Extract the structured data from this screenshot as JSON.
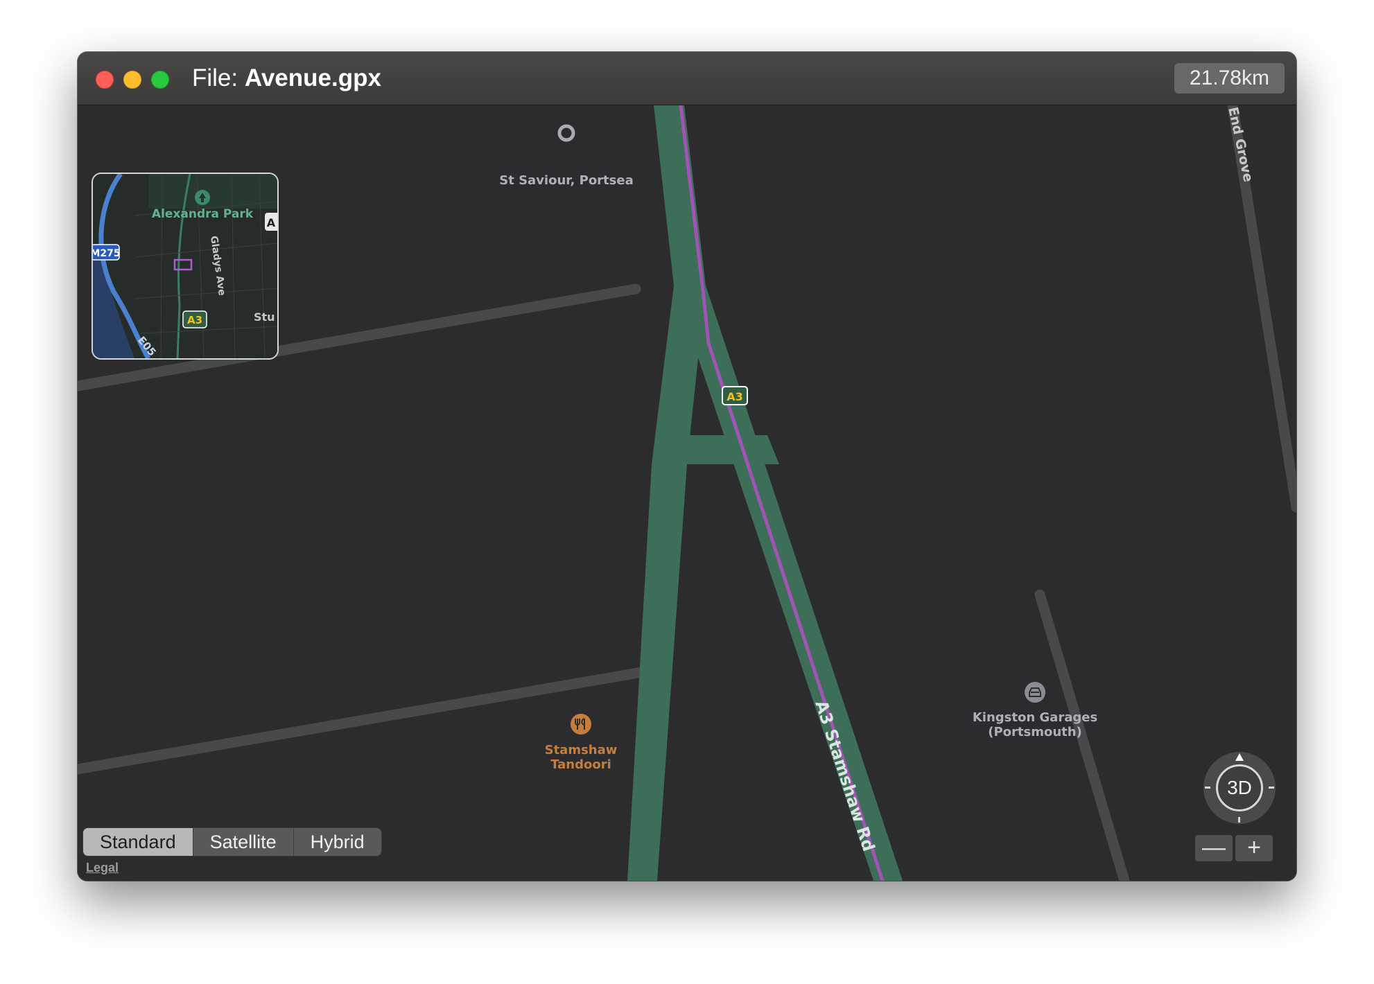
{
  "window": {
    "title_prefix": "File:",
    "title_file": "Avenue.gpx",
    "distance": "21.78km"
  },
  "map": {
    "poi": {
      "st_saviour": "St Saviour, Portsea",
      "stamshaw_tandoori": "Stamshaw Tandoori",
      "kingston_garages": "Kingston Garages (Portsmouth)"
    },
    "road_labels": {
      "a3_shield": "A3",
      "a3_road": "A3  Stamshaw Rd",
      "end_grove": "End Grove"
    },
    "colors": {
      "background": "#2c2c2e",
      "major_road": "#3d6e58",
      "minor_road": "#48494b",
      "route": "#a054b4",
      "restaurant": "#c77e3c",
      "poi_text": "#aeb2b8"
    }
  },
  "minimap": {
    "labels": {
      "park": "Alexandra Park",
      "gladys": "Gladys Ave",
      "m275": "M275",
      "a3": "A3",
      "e05": "E05",
      "stu": "Stu",
      "a_badge": "A"
    }
  },
  "map_type": {
    "options": [
      "Standard",
      "Satellite",
      "Hybrid"
    ],
    "selected": "Standard"
  },
  "legal": "Legal",
  "controls": {
    "compass_label": "3D",
    "zoom_out": "—",
    "zoom_in": "+"
  }
}
